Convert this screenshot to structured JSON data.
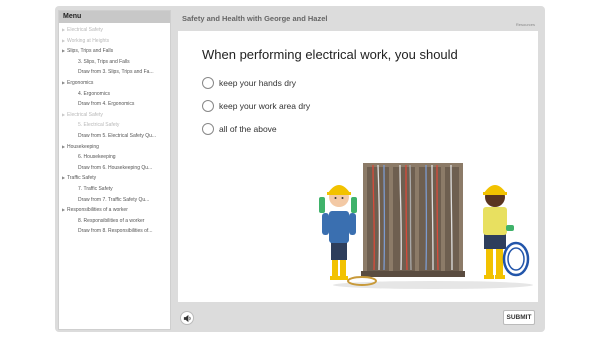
{
  "sidebar": {
    "header": "Menu",
    "items": [
      {
        "label": "Electrical Safety",
        "level": 1,
        "dim": true
      },
      {
        "label": "Working at Heights",
        "level": 1,
        "dim": true
      },
      {
        "label": "Slips, Trips and Falls",
        "level": 1,
        "dim": false
      },
      {
        "label": "3. Slips, Trips and Falls",
        "level": 2,
        "dim": false
      },
      {
        "label": "Draw from 3. Slips, Trips and Fa...",
        "level": 2,
        "dim": false
      },
      {
        "label": "Ergonomics",
        "level": 1,
        "dim": false
      },
      {
        "label": "4. Ergonomics",
        "level": 2,
        "dim": false
      },
      {
        "label": "Draw from 4. Ergonomics",
        "level": 2,
        "dim": false
      },
      {
        "label": "Electrical Safety",
        "level": 1,
        "dim": true
      },
      {
        "label": "5. Electrical Safety",
        "level": 2,
        "dim": true
      },
      {
        "label": "Draw from 5. Electrical Safety Qu...",
        "level": 2,
        "dim": false
      },
      {
        "label": "Housekeeping",
        "level": 1,
        "dim": false
      },
      {
        "label": "6. Housekeeping",
        "level": 2,
        "dim": false
      },
      {
        "label": "Draw from 6. Housekeeping Qu...",
        "level": 2,
        "dim": false
      },
      {
        "label": "Traffic Safety",
        "level": 1,
        "dim": false
      },
      {
        "label": "7. Traffic Safety",
        "level": 2,
        "dim": false
      },
      {
        "label": "Draw from 7. Traffic Safety Qu...",
        "level": 2,
        "dim": false
      },
      {
        "label": "Responsibilities of a worker",
        "level": 1,
        "dim": false
      },
      {
        "label": "8. Responsibilities of a worker",
        "level": 2,
        "dim": false
      },
      {
        "label": "Draw from 8. Responsibilities of...",
        "level": 2,
        "dim": false
      }
    ]
  },
  "header": {
    "course_title": "Safety and Health with George and Hazel",
    "resources_label": "Resources"
  },
  "quiz": {
    "question": "When performing electrical work, you should",
    "options": [
      "keep your hands dry",
      "keep your work area dry",
      "all of the above"
    ]
  },
  "footer": {
    "submit_label": "SUBMIT",
    "audio_icon": "speaker-icon"
  },
  "colors": {
    "frame": "#dcdcdc",
    "sidebar_header": "#c8c8c8",
    "panel": "#7a6a5a",
    "hardhat": "#f2c200",
    "shirt_blue": "#3a6fb0",
    "shirt_yellow": "#e8e060",
    "cable_blue": "#2255aa"
  }
}
